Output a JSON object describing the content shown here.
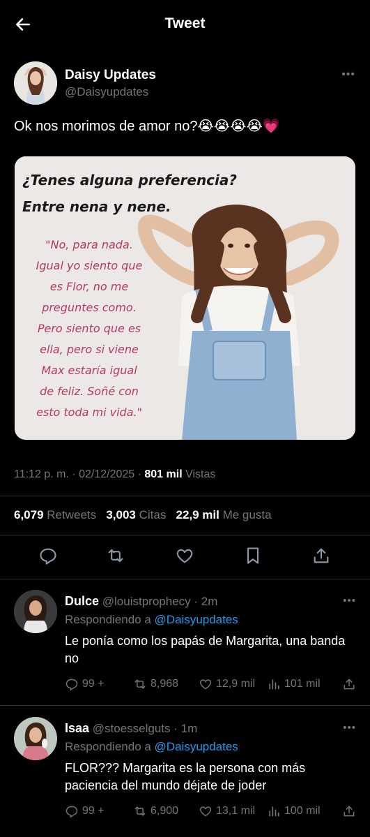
{
  "header": {
    "title": "Tweet"
  },
  "tweet": {
    "author_name": "Daisy Updates",
    "author_handle": "@Daisyupdates",
    "text": "Ok nos morimos de amor no?😭😭😭😭💗",
    "media": {
      "question_line1": "¿Tenes alguna preferencia?",
      "question_line2": "Entre nena y nene.",
      "quote_lines": [
        "\"No, para nada.",
        "Igual yo siento que",
        "es Flor, no me",
        "preguntes como.",
        "Pero siento que es",
        "ella, pero si viene",
        "Max estaría igual",
        "de feliz. Soñé con",
        "esto toda mi vida.\""
      ]
    },
    "timestamp": "11:12 p. m. · 02/12/2025 · ",
    "views_count": "801 mil",
    "views_label": " Vistas",
    "retweets_count": "6,079",
    "retweets_label": " Retweets",
    "quotes_count": "3,003",
    "quotes_label": " Citas",
    "likes_count": "22,9 mil",
    "likes_label": " Me gusta"
  },
  "replies": [
    {
      "name": "Dulce",
      "handle_time": " @louistprophecy · 2m",
      "replying_prefix": "Respondiendo a ",
      "replying_to": "@Daisyupdates",
      "text": "Le ponía como los papás de Margarita, una banda no",
      "replies": "99 +",
      "retweets": "8,968",
      "likes": "12,9 mil",
      "views": "101 mil"
    },
    {
      "name": "Isaa",
      "handle_time": " @stoesselguts · 1m",
      "replying_prefix": "Respondiendo a ",
      "replying_to": "@Daisyupdates",
      "text": "FLOR??? Margarita es la persona con más paciencia del mundo déjate de joder",
      "replies": "99 +",
      "retweets": "6,900",
      "likes": "13,1 mil",
      "views": "100 mil"
    }
  ],
  "colors": {
    "background": "#000000",
    "link": "#1d9bf0",
    "muted": "#71767b",
    "quote_pink": "#b5386b"
  },
  "icons": [
    "back-arrow-icon",
    "more-icon",
    "reply-icon",
    "retweet-icon",
    "like-icon",
    "bookmark-icon",
    "share-icon",
    "views-icon"
  ]
}
